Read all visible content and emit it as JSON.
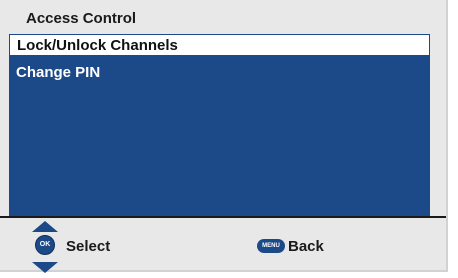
{
  "screen": {
    "title": "Access Control"
  },
  "menu": {
    "items": [
      {
        "label": "Lock/Unlock Channels",
        "selected": true
      },
      {
        "label": "Change PIN",
        "selected": false
      }
    ]
  },
  "footer": {
    "ok_icon_text": "OK",
    "select_label": "Select",
    "menu_icon_text": "MENU",
    "back_label": "Back"
  },
  "colors": {
    "panel": "#1c4a88",
    "background": "#e8e8e8",
    "highlight": "#ffffff"
  }
}
